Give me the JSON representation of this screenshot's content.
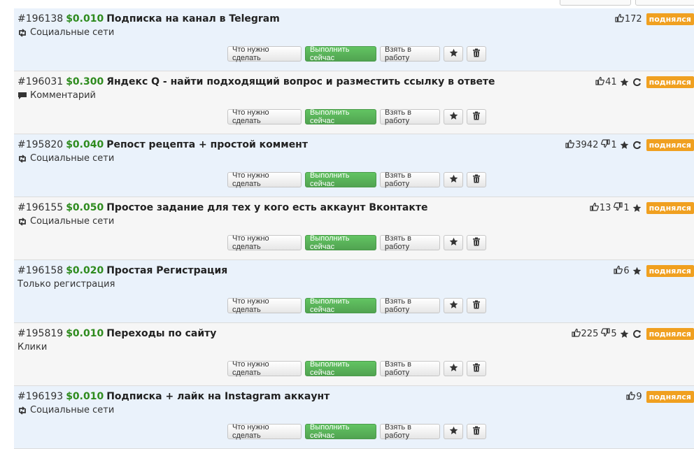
{
  "buttons": {
    "what_to_do": "Что нужно сделать",
    "do_now": "Выполнить сейчас",
    "take": "Взять в работу"
  },
  "colors": {
    "price": "#2e8b1e",
    "badge": "#f0a020",
    "green_button": "#5cb85c"
  },
  "tasks": [
    {
      "id": "#196138",
      "price": "$0.010",
      "title": "Подписка на канал в Telegram",
      "category": "Социальные сети",
      "category_icon": "retweet-icon",
      "likes": "172",
      "dislikes": null,
      "star": false,
      "refresh": false,
      "badge": "поднялся"
    },
    {
      "id": "#196031",
      "price": "$0.300",
      "title": "Яндекс Q - найти подходящий вопрос и разместить ссылку в ответе",
      "category": "Комментарий",
      "category_icon": "comment-icon",
      "likes": "41",
      "dislikes": null,
      "star": true,
      "refresh": true,
      "badge": "поднялся"
    },
    {
      "id": "#195820",
      "price": "$0.040",
      "title": "Репост рецепта + простой коммент",
      "category": "Социальные сети",
      "category_icon": "retweet-icon",
      "likes": "3942",
      "dislikes": "1",
      "star": true,
      "refresh": true,
      "badge": "поднялся"
    },
    {
      "id": "#196155",
      "price": "$0.050",
      "title": "Простое задание для тех у кого есть аккаунт Вконтакте",
      "category": "Социальные сети",
      "category_icon": "retweet-icon",
      "likes": "13",
      "dislikes": "1",
      "star": true,
      "refresh": false,
      "badge": "поднялся"
    },
    {
      "id": "#196158",
      "price": "$0.020",
      "title": "Простая Регистрация",
      "category": "Только регистрация",
      "category_icon": null,
      "likes": "6",
      "dislikes": null,
      "star": true,
      "refresh": false,
      "badge": "поднялся"
    },
    {
      "id": "#195819",
      "price": "$0.010",
      "title": "Переходы по сайту",
      "category": "Клики",
      "category_icon": null,
      "likes": "225",
      "dislikes": "5",
      "star": true,
      "refresh": true,
      "badge": "поднялся"
    },
    {
      "id": "#196193",
      "price": "$0.010",
      "title": "Подписка + лайк на Instagram аккаунт",
      "category": "Социальные сети",
      "category_icon": "retweet-icon",
      "likes": "9",
      "dislikes": null,
      "star": false,
      "refresh": false,
      "badge": "поднялся"
    }
  ]
}
